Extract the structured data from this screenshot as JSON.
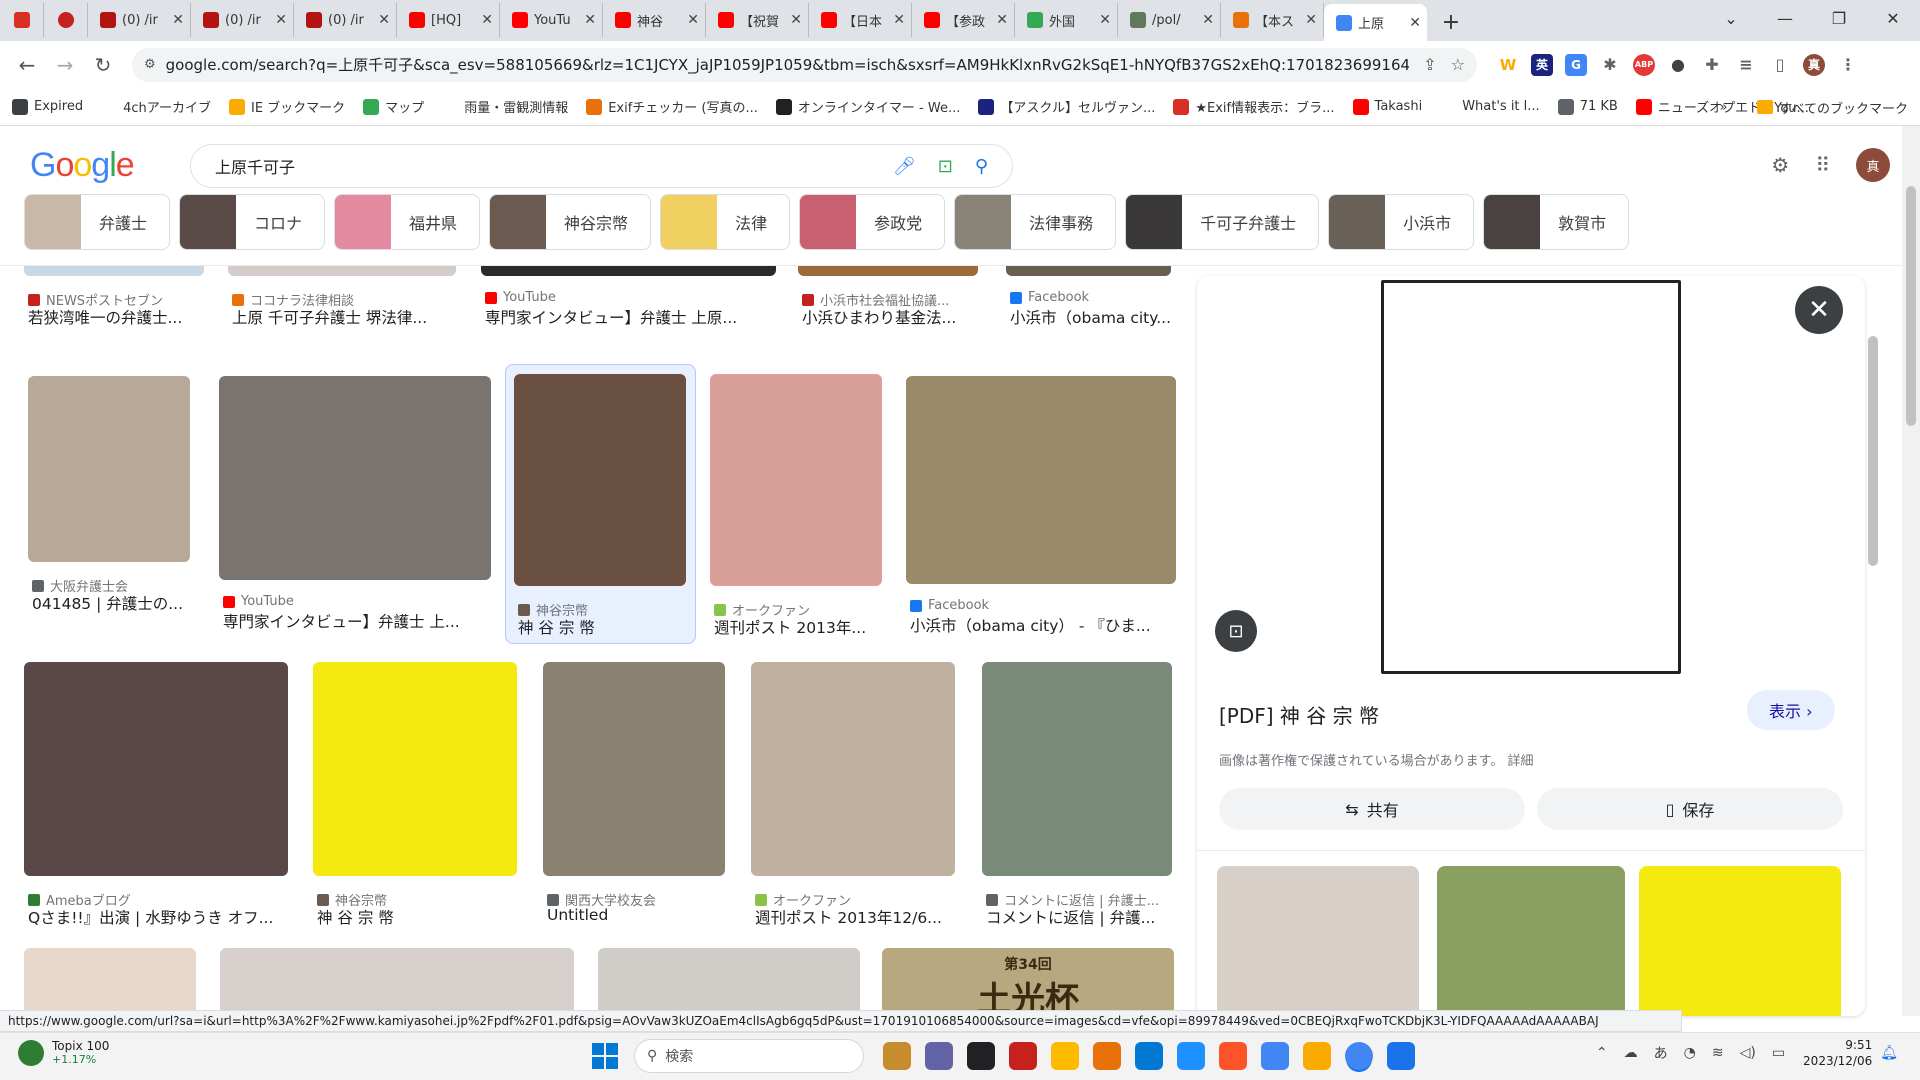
{
  "tabs": [
    {
      "label": "",
      "color": "#d93025"
    },
    {
      "label": "",
      "color": "#c5221f"
    },
    {
      "label": "(0) /ir",
      "color": "#b31412"
    },
    {
      "label": "(0) /ir",
      "color": "#b31412"
    },
    {
      "label": "(0) /ir",
      "color": "#b31412"
    },
    {
      "label": "[HQ]",
      "color": "#ff0000"
    },
    {
      "label": "YouTu",
      "color": "#ff0000"
    },
    {
      "label": "神谷",
      "color": "#ff0000"
    },
    {
      "label": "【祝賀",
      "color": "#ff0000"
    },
    {
      "label": "【日本",
      "color": "#ff0000"
    },
    {
      "label": "【参政",
      "color": "#ff0000"
    },
    {
      "label": "外国",
      "color": "#34a853"
    },
    {
      "label": "/pol/",
      "color": "#5f7a5a"
    },
    {
      "label": "【本ス",
      "color": "#e8710a"
    },
    {
      "label": "上原",
      "color": "#4285f4"
    }
  ],
  "window": {
    "minimize": "⌄",
    "min": "—",
    "restore": "❐",
    "close": "✕"
  },
  "toolbar": {
    "url": "google.com/search?q=上原千可子&sca_esv=588105669&rlz=1C1JCYX_jaJP1059JP1059&tbm=isch&sxsrf=AM9HkKlxnRvG2kSqE1-hNYQfB37GS2xEhQ:1701823699164...",
    "extensions": [
      {
        "label": "W",
        "color": "#f9ab00"
      },
      {
        "label": "英",
        "color": "#1a237e"
      },
      {
        "label": "G",
        "color": "#4285f4"
      },
      {
        "label": "✱",
        "color": "#5f6368"
      },
      {
        "label": "ABP",
        "color": "#e53935"
      },
      {
        "label": "●",
        "color": "#424242"
      },
      {
        "label": "✚",
        "color": "#5f6368"
      },
      {
        "label": "≡",
        "color": "#5f6368"
      },
      {
        "label": "▯",
        "color": "#5f6368"
      },
      {
        "label": "真",
        "color": "#8d4c3a"
      },
      {
        "label": "⋮",
        "color": "#5f6368"
      }
    ]
  },
  "bookmarks": {
    "items": [
      {
        "label": "Expired",
        "color": "#3c4043"
      },
      {
        "label": "4chアーカイブ",
        "color": "#ffffff"
      },
      {
        "label": "IE ブックマーク",
        "color": "#f9ab00"
      },
      {
        "label": "マップ",
        "color": "#34a853"
      },
      {
        "label": "雨量・雷観測情報",
        "color": "#ffffff"
      },
      {
        "label": "Exifチェッカー (写真の...",
        "color": "#e8710a"
      },
      {
        "label": "オンラインタイマー - We...",
        "color": "#202124"
      },
      {
        "label": "【アスクル】セルヴァン...",
        "color": "#1a237e"
      },
      {
        "label": "★Exif情報表示：ブラ...",
        "color": "#d93025"
      },
      {
        "label": "Takashi",
        "color": "#ff0000"
      },
      {
        "label": "What's it l...",
        "color": "#ffffff"
      },
      {
        "label": "71 KB",
        "color": "#5f6368"
      },
      {
        "label": "ニューズオプエド - You...",
        "color": "#ff0000"
      }
    ],
    "more": "»",
    "all": "すべてのブックマーク"
  },
  "google": {
    "logo": "Google",
    "query": "上原千可子",
    "chips": [
      {
        "label": "弁護士",
        "color": "#c9b8a8"
      },
      {
        "label": "コロナ",
        "color": "#5a4a48"
      },
      {
        "label": "福井県",
        "color": "#e48aa0"
      },
      {
        "label": "神谷宗幣",
        "color": "#6a5a50"
      },
      {
        "label": "法律",
        "color": "#f0d060"
      },
      {
        "label": "参政党",
        "color": "#c86070"
      },
      {
        "label": "法律事務",
        "color": "#8a8478"
      },
      {
        "label": "千可子弁護士",
        "color": "#3a3838"
      },
      {
        "label": "小浜市",
        "color": "#6a6258"
      },
      {
        "label": "敦賀市",
        "color": "#4a4240"
      }
    ]
  },
  "results": [
    {
      "source": "NEWSポストセブン",
      "title": "若狭湾唯一の弁護士...",
      "fav": "#c5221f",
      "color": "#c8d8e4"
    },
    {
      "source": "ココナラ法律相談",
      "title": "上原 千可子弁護士 堺法律...",
      "fav": "#e8710a",
      "color": "#d4ccc8"
    },
    {
      "source": "YouTube",
      "title": "専門家インタビュー】弁護士 上原...",
      "fav": "#ff0000",
      "color": "#2a2a2a"
    },
    {
      "source": "小浜市社会福祉協議...",
      "title": "小浜ひまわり基金法...",
      "fav": "#c5221f",
      "color": "#9a6a3a"
    },
    {
      "source": "Facebook",
      "title": "小浜市（obama city...",
      "fav": "#1877f2",
      "color": "#6a5e50"
    },
    {
      "source": "大阪弁護士会",
      "title": "041485 | 弁護士の...",
      "fav": "#5f6368",
      "color": "#b8a898"
    },
    {
      "source": "YouTube",
      "title": "専門家インタビュー】弁護士 上...",
      "fav": "#ff0000",
      "color": "#7a7470"
    },
    {
      "source": "神谷宗幣",
      "title": "神 谷 宗 幣",
      "fav": "#6a5a50",
      "color": "#6a5040"
    },
    {
      "source": "オークファン",
      "title": "週刊ポスト 2013年...",
      "fav": "#8bc34a",
      "color": "#d8a098"
    },
    {
      "source": "Facebook",
      "title": "小浜市（obama city） - 『ひま...",
      "fav": "#1877f2",
      "color": "#9a8a6a"
    },
    {
      "source": "Amebaブログ",
      "title": "Qさま!!』出演 | 水野ゆうき オフ...",
      "fav": "#2e7d32",
      "color": "#5a4848"
    },
    {
      "source": "神谷宗幣",
      "title": "神 谷 宗 幣",
      "fav": "#6a5a50",
      "color": "#f5ea10"
    },
    {
      "source": "関西大学校友会",
      "title": "Untitled",
      "fav": "#5f6368",
      "color": "#8a8070"
    },
    {
      "source": "オークファン",
      "title": "週刊ポスト 2013年12/6...",
      "fav": "#8bc34a",
      "color": "#c0b0a0"
    },
    {
      "source": "コメントに返信 | 弁護士...",
      "title": "コメントに返信 | 弁護...",
      "fav": "#5f6368",
      "color": "#7a8a78"
    },
    {
      "source": "",
      "title": "",
      "fav": "#ffffff",
      "color": "#e8d8cc"
    },
    {
      "source": "",
      "title": "",
      "fav": "#ffffff",
      "color": "#d8d0cc"
    },
    {
      "source": "",
      "title": "",
      "fav": "#ffffff",
      "color": "#d0ccc8"
    },
    {
      "source": "",
      "title": "土光杯",
      "fav": "#ffffff",
      "color": "#b8a880",
      "overlay": "第34回"
    }
  ],
  "panel": {
    "title": "[PDF] 神 谷 宗 幣",
    "show": "表示 ›",
    "copyright": "画像は著作権で保護されている場合があります。 詳細",
    "share": "共有",
    "save": "保存",
    "related_colors": [
      "#d8d0c8",
      "#8aa060",
      "#f5ea10"
    ]
  },
  "status": {
    "url": "https://www.google.com/url?sa=i&url=http%3A%2F%2Fwww.kamiyasohei.jp%2Fpdf%2F01.pdf&psig=AOvVaw3kUZOaEm4clIsAgb6gq5dP&ust=1701910106854000&source=images&cd=vfe&opi=89978449&ved=0CBEQjRxqFwoTCKDbjK3L-YIDFQAAAAAdAAAAABAJ"
  },
  "taskbar": {
    "widget_title": "Topix 100",
    "widget_change": "+1.17%",
    "search_placeholder": "検索",
    "apps": [
      "#c78c2e",
      "#6264a7",
      "#202124",
      "#c5221f",
      "#ffb900",
      "#e8710a",
      "#0078d4",
      "#1e90ff",
      "#fb542b",
      "#4285f4",
      "#f9ab00",
      "#4285f4",
      "#1a73e8"
    ],
    "ime": "あ",
    "time": "9:51",
    "date": "2023/12/06"
  }
}
